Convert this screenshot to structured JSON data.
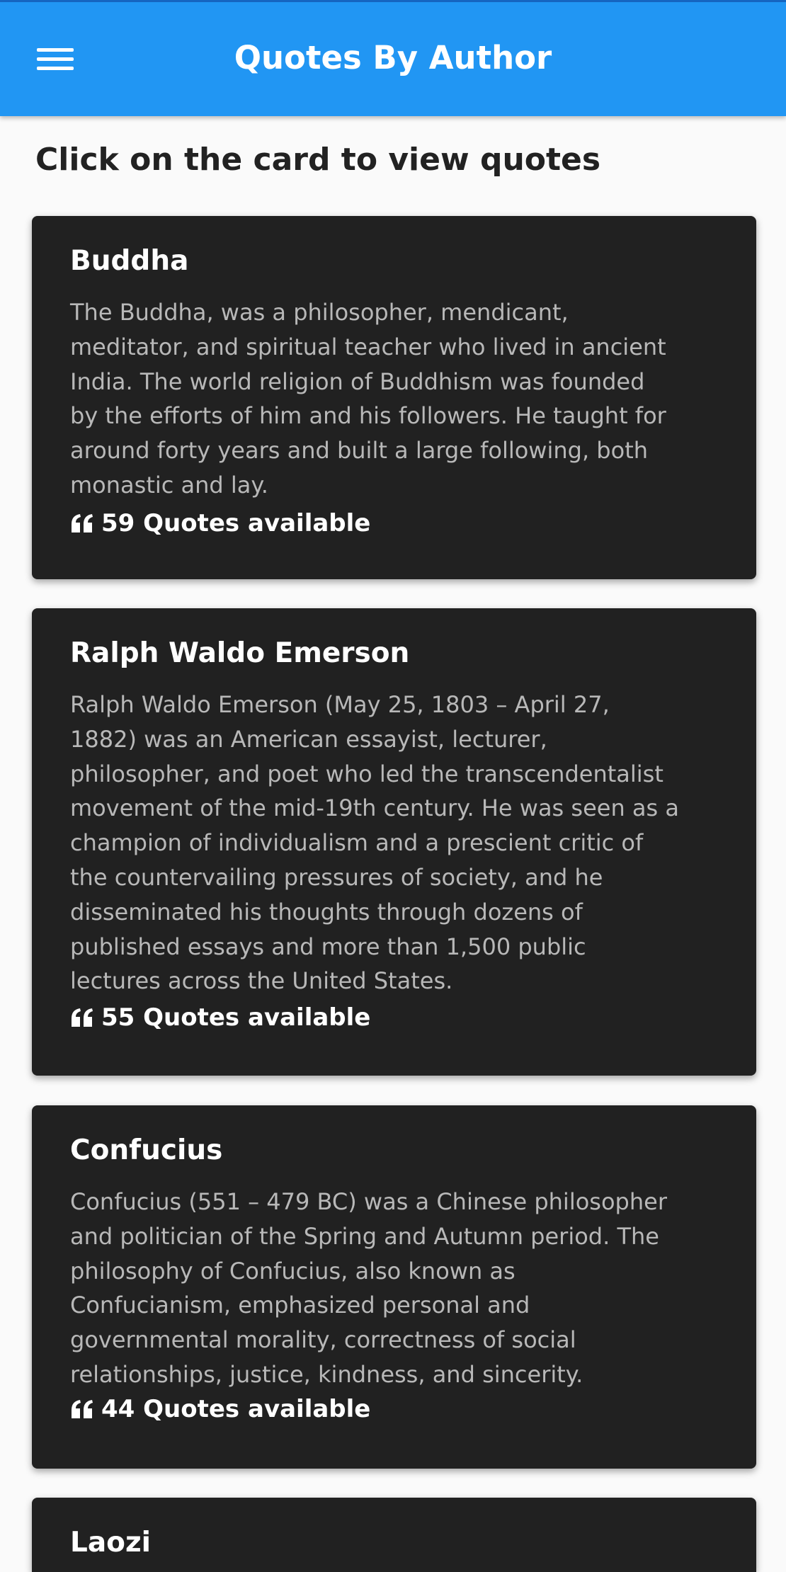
{
  "appbar": {
    "title": "Quotes By Author",
    "menu_icon": "hamburger-menu-icon",
    "color": "#2196f3"
  },
  "heading": "Click on the card to view quotes",
  "cards": [
    {
      "name": "Buddha",
      "lines": [
        "The Buddha, was a philosopher, mendicant,",
        "meditator, and spiritual teacher who lived in ancient",
        "India. The world religion of Buddhism was founded",
        "by the efforts of him and his followers. He taught for",
        "around forty years and built a large following, both",
        "monastic and lay."
      ],
      "quotes": "59 Quotes available"
    },
    {
      "name": "Ralph Waldo Emerson",
      "lines": [
        "Ralph Waldo Emerson (May 25, 1803 – April 27,",
        "1882) was an American essayist, lecturer,",
        "philosopher, and poet who led the transcendentalist",
        "movement of the mid-19th century. He was seen as a",
        "champion of individualism and a prescient critic of",
        "the countervailing pressures of society, and he",
        "disseminated his thoughts through dozens of",
        "published essays and more than 1,500 public",
        "lectures across the United States."
      ],
      "quotes": "55 Quotes available"
    },
    {
      "name": "Confucius",
      "lines": [
        "Confucius (551 – 479 BC) was a Chinese philosopher",
        "and politician of the Spring and Autumn period. The",
        "philosophy of Confucius, also known as",
        "Confucianism, emphasized personal and",
        "governmental morality, correctness of social",
        "relationships, justice, kindness, and sincerity."
      ],
      "quotes": "44 Quotes available"
    },
    {
      "name": "Laozi",
      "lines": [],
      "quotes": ""
    }
  ],
  "icons": {
    "quote": "quote-icon"
  },
  "colors": {
    "card_background": "#212121",
    "card_text": "#b8b8b8",
    "title_text": "#ffffff"
  }
}
